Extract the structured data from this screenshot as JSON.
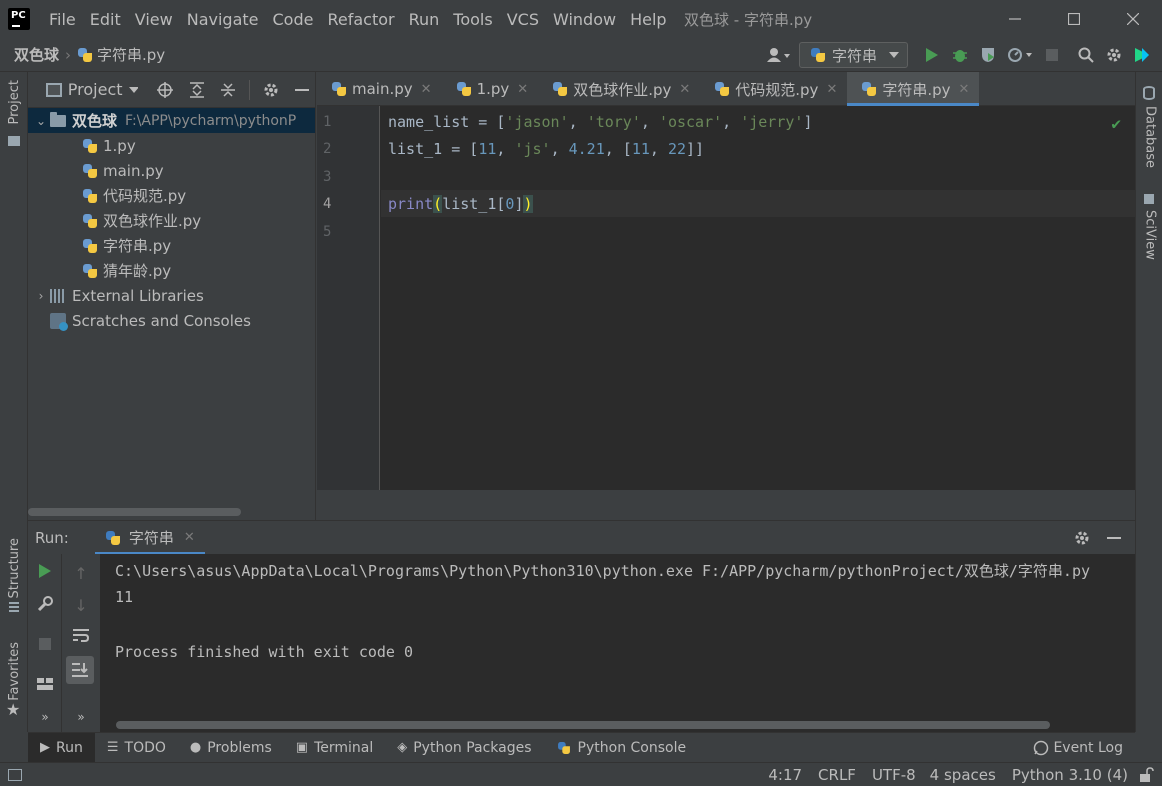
{
  "menu": [
    "File",
    "Edit",
    "View",
    "Navigate",
    "Code",
    "Refactor",
    "Run",
    "Tools",
    "VCS",
    "Window",
    "Help"
  ],
  "window_title": "双色球 - 字符串.py",
  "breadcrumb": {
    "project": "双色球",
    "file": "字符串.py"
  },
  "run_config": "字符串",
  "project_panel": {
    "title": "Project",
    "root": {
      "name": "双色球",
      "path": "F:\\APP\\pycharm\\pythonP"
    },
    "files": [
      "1.py",
      "main.py",
      "代码规范.py",
      "双色球作业.py",
      "字符串.py",
      "猜年龄.py"
    ],
    "external_libraries": "External Libraries",
    "scratches": "Scratches and Consoles"
  },
  "left_stripe": {
    "project": "Project",
    "structure": "Structure",
    "favorites": "Favorites"
  },
  "right_stripe": {
    "database": "Database",
    "sciview": "SciView"
  },
  "editor_tabs": [
    "main.py",
    "1.py",
    "双色球作业.py",
    "代码规范.py",
    "字符串.py"
  ],
  "active_tab": "字符串.py",
  "code": {
    "line_numbers": [
      "1",
      "2",
      "3",
      "4",
      "5"
    ],
    "l1": {
      "var": "name_list = [",
      "s1": "'jason'",
      "c1": ", ",
      "s2": "'tory'",
      "c2": ", ",
      "s3": "'oscar'",
      "c3": ", ",
      "s4": "'jerry'",
      "end": "]"
    },
    "l2": {
      "var": "list_1 = [",
      "n1": "11",
      "c1": ", ",
      "s1": "'js'",
      "c2": ", ",
      "n2": "4.21",
      "c3": ", [",
      "n3": "11",
      "c4": ", ",
      "n4": "22",
      "end": "]]"
    },
    "l4": {
      "fn": "print",
      "open": "(",
      "mid": "list_1[",
      "idx": "0",
      "close_sq": "]",
      "close": ")"
    }
  },
  "run_panel": {
    "label": "Run:",
    "tab": "字符串",
    "output": [
      "C:\\Users\\asus\\AppData\\Local\\Programs\\Python\\Python310\\python.exe F:/APP/pycharm/pythonProject/双色球/字符串.py",
      "11",
      "",
      "Process finished with exit code 0"
    ]
  },
  "tool_windows": [
    "Run",
    "TODO",
    "Problems",
    "Terminal",
    "Python Packages",
    "Python Console"
  ],
  "event_log": "Event Log",
  "status": {
    "position": "4:17",
    "line_sep": "CRLF",
    "encoding": "UTF-8",
    "indent": "4 spaces",
    "interpreter": "Python 3.10 (4)"
  }
}
